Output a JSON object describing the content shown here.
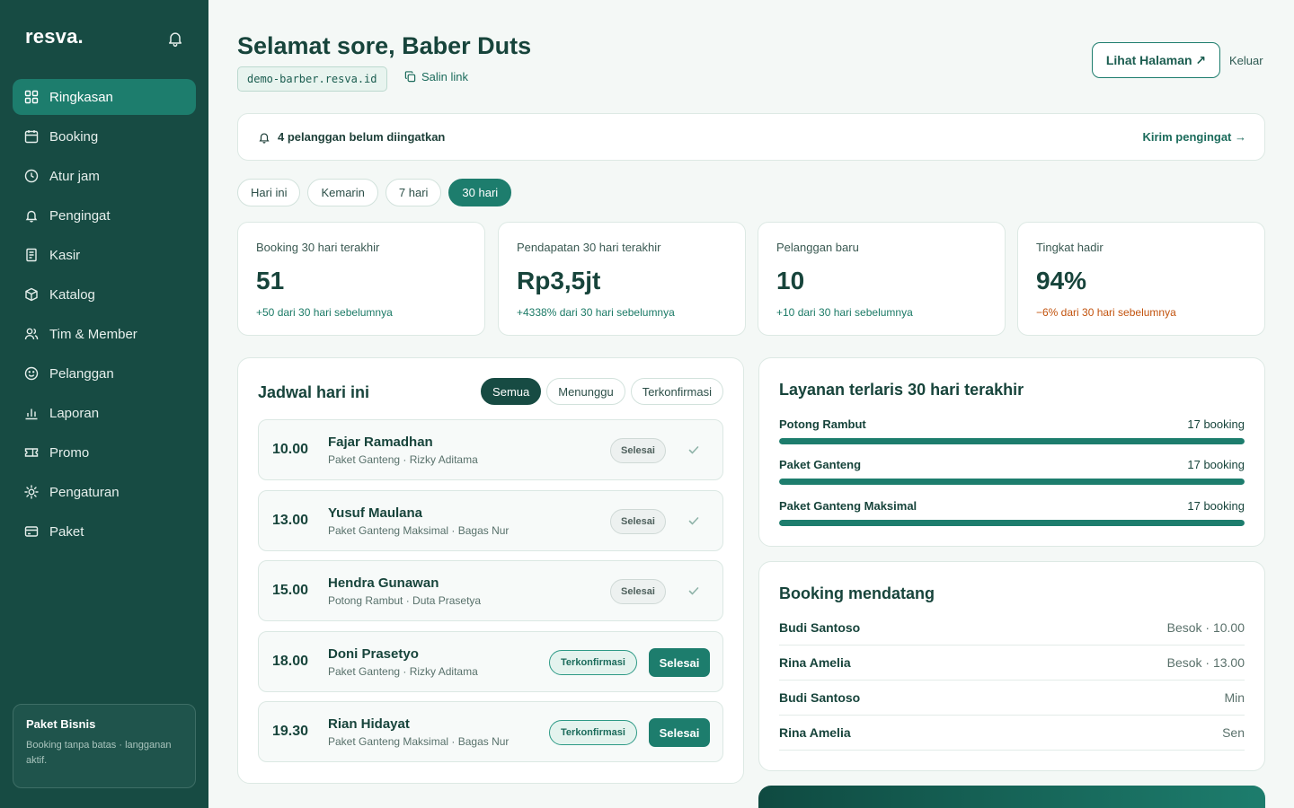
{
  "brand": {
    "logo": "resva."
  },
  "sidebar": {
    "items": [
      {
        "label": "Ringkasan",
        "icon": "grid-icon",
        "active": true
      },
      {
        "label": "Booking",
        "icon": "calendar-icon"
      },
      {
        "label": "Atur jam",
        "icon": "clock-icon"
      },
      {
        "label": "Pengingat",
        "icon": "bell-icon"
      },
      {
        "label": "Kasir",
        "icon": "receipt-icon"
      },
      {
        "label": "Katalog",
        "icon": "box-icon"
      },
      {
        "label": "Tim & Member",
        "icon": "users-icon"
      },
      {
        "label": "Pelanggan",
        "icon": "smile-icon"
      },
      {
        "label": "Laporan",
        "icon": "bar-chart-icon"
      },
      {
        "label": "Promo",
        "icon": "ticket-icon"
      },
      {
        "label": "Pengaturan",
        "icon": "sun-gear-icon"
      },
      {
        "label": "Paket",
        "icon": "card-icon"
      }
    ],
    "plan": {
      "title": "Paket Bisnis",
      "desc": "Booking tanpa batas · langganan aktif."
    }
  },
  "header": {
    "greeting": "Selamat sore, Baber Duts",
    "domain": "demo-barber.resva.id",
    "copy_label": "Salin link",
    "view_page": "Lihat Halaman ↗",
    "logout": "Keluar"
  },
  "reminder": {
    "text": "4 pelanggan belum diingatkan",
    "action": "Kirim pengingat →"
  },
  "filters": [
    {
      "label": "Hari ini"
    },
    {
      "label": "Kemarin"
    },
    {
      "label": "7 hari"
    },
    {
      "label": "30 hari",
      "active": true
    }
  ],
  "stats": [
    {
      "label": "Booking 30 hari terakhir",
      "value": "51",
      "delta": "+50 dari 30 hari sebelumnya",
      "trend": "up"
    },
    {
      "label": "Pendapatan 30 hari terakhir",
      "value": "Rp3,5jt",
      "delta": "+4338% dari 30 hari sebelumnya",
      "trend": "up"
    },
    {
      "label": "Pelanggan baru",
      "value": "10",
      "delta": "+10 dari 30 hari sebelumnya",
      "trend": "up"
    },
    {
      "label": "Tingkat hadir",
      "value": "94%",
      "delta": "−6% dari 30 hari sebelumnya",
      "trend": "down"
    }
  ],
  "colors": {
    "up": "#1b7a66",
    "down": "#c2530e",
    "accent": "#1d7d6d",
    "sidebar": "#174b43"
  },
  "schedule": {
    "title": "Jadwal hari ini",
    "tabs": [
      {
        "label": "Semua",
        "active": true
      },
      {
        "label": "Menunggu"
      },
      {
        "label": "Terkonfirmasi"
      }
    ],
    "items": [
      {
        "time": "10.00",
        "name": "Fajar Ramadhan",
        "detail": "Paket Ganteng · Rizky Aditama",
        "status": "Selesai",
        "done": true
      },
      {
        "time": "13.00",
        "name": "Yusuf Maulana",
        "detail": "Paket Ganteng Maksimal · Bagas Nur",
        "status": "Selesai",
        "done": true
      },
      {
        "time": "15.00",
        "name": "Hendra Gunawan",
        "detail": "Potong Rambut · Duta Prasetya",
        "status": "Selesai",
        "done": true
      },
      {
        "time": "18.00",
        "name": "Doni Prasetyo",
        "detail": "Paket Ganteng · Rizky Aditama",
        "status": "Terkonfirmasi",
        "action": "Selesai",
        "done": false
      },
      {
        "time": "19.30",
        "name": "Rian Hidayat",
        "detail": "Paket Ganteng Maksimal · Bagas Nur",
        "status": "Terkonfirmasi",
        "action": "Selesai",
        "done": false
      }
    ]
  },
  "services": {
    "title": "Layanan terlaris 30 hari terakhir",
    "items": [
      {
        "name": "Potong Rambut",
        "count": "17 booking",
        "share": 1
      },
      {
        "name": "Paket Ganteng",
        "count": "17 booking",
        "share": 1
      },
      {
        "name": "Paket Ganteng Maksimal",
        "count": "17 booking",
        "share": 1
      }
    ]
  },
  "upcoming": {
    "title": "Booking mendatang",
    "items": [
      {
        "name": "Budi Santoso",
        "when": "Besok · 10.00"
      },
      {
        "name": "Rina Amelia",
        "when": "Besok · 13.00"
      },
      {
        "name": "Budi Santoso",
        "when": "Min"
      },
      {
        "name": "Rina Amelia",
        "when": "Sen"
      }
    ]
  }
}
